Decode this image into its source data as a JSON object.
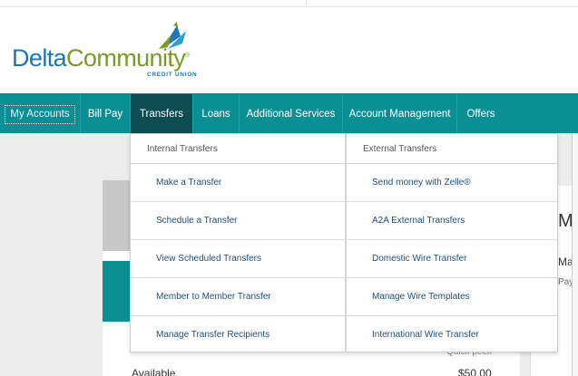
{
  "logo": {
    "name_part1": "Delta",
    "name_part2": "Community",
    "registered": "®",
    "subtitle": "CREDIT UNION"
  },
  "nav": {
    "items": [
      {
        "label": "My Accounts"
      },
      {
        "label": "Bill Pay"
      },
      {
        "label": "Transfers"
      },
      {
        "label": "Loans"
      },
      {
        "label": "Additional Services"
      },
      {
        "label": "Account Management"
      },
      {
        "label": "Offers"
      }
    ],
    "active": "Transfers"
  },
  "dropdown": {
    "internal": {
      "heading": "Internal Transfers",
      "links": [
        "Make a Transfer",
        "Schedule a Transfer",
        "View Scheduled Transfers",
        "Member to Member Transfer",
        "Manage Transfer Recipients"
      ]
    },
    "external": {
      "heading": "External Transfers",
      "links": [
        "Send money with Zelle®",
        "A2A External Transfers",
        "Domestic Wire Transfer",
        "Manage Wire Templates",
        "International Wire Transfer"
      ]
    }
  },
  "background": {
    "available_label": "Available",
    "available_amount": "$50.00",
    "quick_peek": "Quick peek",
    "right_heading": "Ma",
    "right_line1": "Mak",
    "right_line2": "Pay"
  },
  "colors": {
    "nav_bg": "#0a8f94",
    "nav_active": "#0c4d52",
    "link": "#1f4f7a",
    "brand_blue": "#1c77b4",
    "brand_green": "#7a9a2a"
  }
}
